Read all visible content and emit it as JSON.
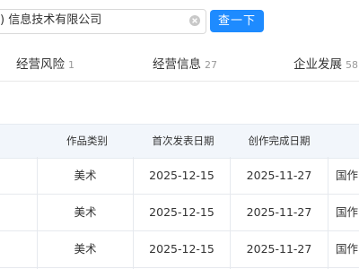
{
  "search": {
    "value": ") 信息技术有限公司",
    "button_label": "查一下"
  },
  "tabs": [
    {
      "label": "经营风险",
      "count": "1"
    },
    {
      "label": "经营信息",
      "count": "27"
    },
    {
      "label": "企业发展",
      "count": "58"
    }
  ],
  "table": {
    "headers": [
      "作品类别",
      "首次发表日期",
      "创作完成日期"
    ],
    "rows": [
      {
        "category": "美术",
        "publish_date": "2025-12-15",
        "complete_date": "2025-11-27",
        "extra": "国作"
      },
      {
        "category": "美术",
        "publish_date": "2025-12-15",
        "complete_date": "2025-11-27",
        "extra": "国作"
      },
      {
        "category": "美术",
        "publish_date": "2025-12-15",
        "complete_date": "2025-11-27",
        "extra": "国作"
      }
    ]
  },
  "colors": {
    "accent": "#1e8bff",
    "header_bg": "#f2f6fb"
  },
  "icons": {
    "clear": "clear-icon"
  }
}
